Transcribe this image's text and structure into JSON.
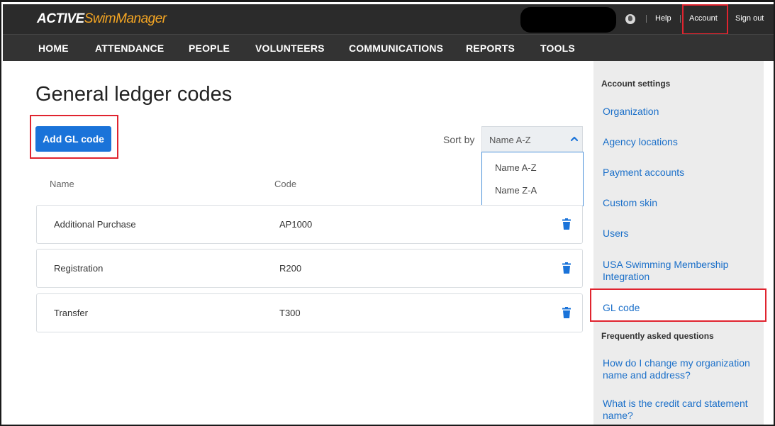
{
  "header": {
    "logo_active": "ACTIVE",
    "logo_swim": "SwimManager",
    "links": {
      "help": "Help",
      "account": "Account",
      "signout": "Sign out"
    }
  },
  "nav": {
    "items": [
      "HOME",
      "ATTENDANCE",
      "PEOPLE",
      "VOLUNTEERS",
      "COMMUNICATIONS",
      "REPORTS",
      "TOOLS"
    ]
  },
  "main": {
    "title": "General ledger codes",
    "add_button": "Add GL code",
    "sort": {
      "label": "Sort by",
      "value": "Name A-Z",
      "options": [
        "Name A-Z",
        "Name Z-A"
      ]
    },
    "columns": {
      "name": "Name",
      "code": "Code"
    },
    "rows": [
      {
        "name": "Additional Purchase",
        "code": "AP1000"
      },
      {
        "name": "Registration",
        "code": "R200"
      },
      {
        "name": "Transfer",
        "code": "T300"
      }
    ]
  },
  "sidebar": {
    "account_heading": "Account settings",
    "account_links": [
      "Organization",
      "Agency locations",
      "Payment accounts",
      "Custom skin",
      "Users",
      "USA Swimming Membership Integration",
      "GL code"
    ],
    "faq_heading": "Frequently asked questions",
    "faq_links": [
      "How do I change my organization name and address?",
      "What is the credit card statement name?"
    ]
  },
  "colors": {
    "primary_blue": "#1a73d9",
    "link_blue": "#1a6fc9",
    "highlight_red": "#e0242f",
    "logo_orange": "#f5a623",
    "topbar_bg": "#2b2b2b"
  }
}
